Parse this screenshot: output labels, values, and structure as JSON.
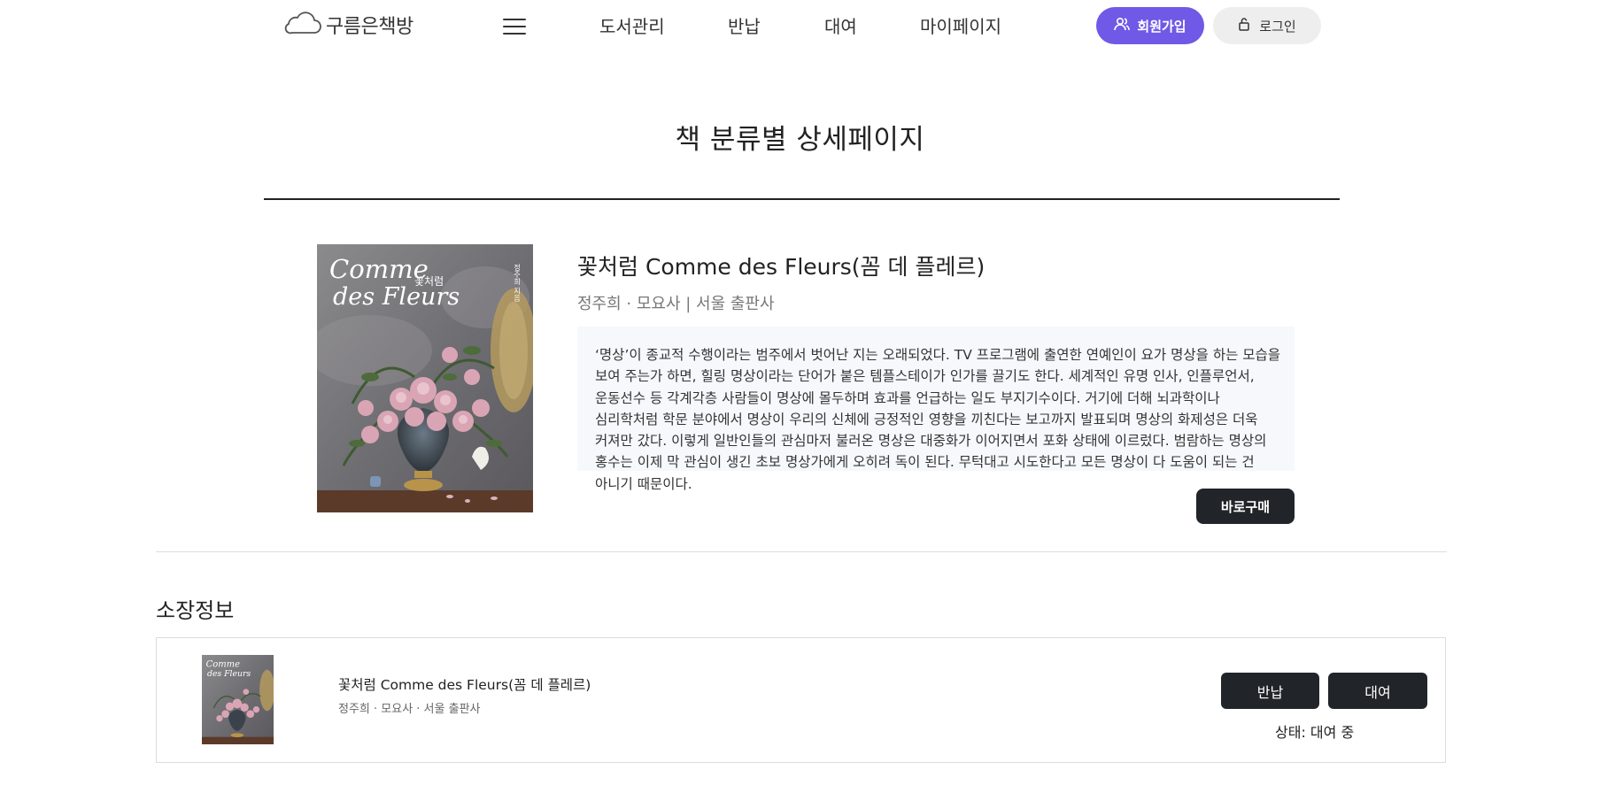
{
  "header": {
    "logo_text": "구름은책방",
    "nav": [
      {
        "label": "도서관리"
      },
      {
        "label": "반납"
      },
      {
        "label": "대여"
      },
      {
        "label": "마이페이지"
      }
    ],
    "signup_label": "회원가입",
    "login_label": "로그인",
    "accent_color": "#7059e6"
  },
  "page": {
    "title": "책 분류별 상세페이지"
  },
  "book": {
    "title": "꽃처럼 Comme des Fleurs(꼼 데 플레르)",
    "meta": "정주희 · 모요사 | 서울 출판사",
    "cover_title_line1": "Comme",
    "cover_title_line2": "des Fleurs",
    "cover_korean": "꽃처럼",
    "cover_author_vertical": "정주희 지음",
    "description": "‘명상’이 종교적 수행이라는 범주에서 벗어난 지는 오래되었다. TV 프로그램에 출연한 연예인이 요가 명상을 하는 모습을 보여 주는가 하면, 힐링 명상이라는 단어가 붙은 템플스테이가 인가를 끌기도 한다. 세계적인 유명 인사, 인플루언서, 운동선수 등 각계각층 사람들이 명상에 몰두하며 효과를 언급하는 일도 부지기수이다. 거기에 더해 뇌과학이나 심리학처럼 학문 분야에서 명상이 우리의 신체에 긍정적인 영향을 끼친다는 보고까지 발표되며 명상의 화제성은 더욱 커져만 갔다. 이렇게 일반인들의 관심마저 불러온 명상은 대중화가 이어지면서 포화 상태에 이르렀다. 범람하는 명상의 홍수는 이제 막 관심이 생긴 초보 명상가에게 오히려 독이 된다. 무턱대고 시도한다고 모든 명상이 다 도움이 되는 건 아니기 때문이다.",
    "buy_label": "바로구매"
  },
  "holdings": {
    "heading": "소장정보",
    "items": [
      {
        "title": "꽃처럼 Comme des Fleurs(꼼 데 플레르)",
        "meta": "정주희 · 모요사 · 서울 출판사",
        "return_label": "반납",
        "rent_label": "대여",
        "status": "상태: 대여 중"
      }
    ]
  }
}
